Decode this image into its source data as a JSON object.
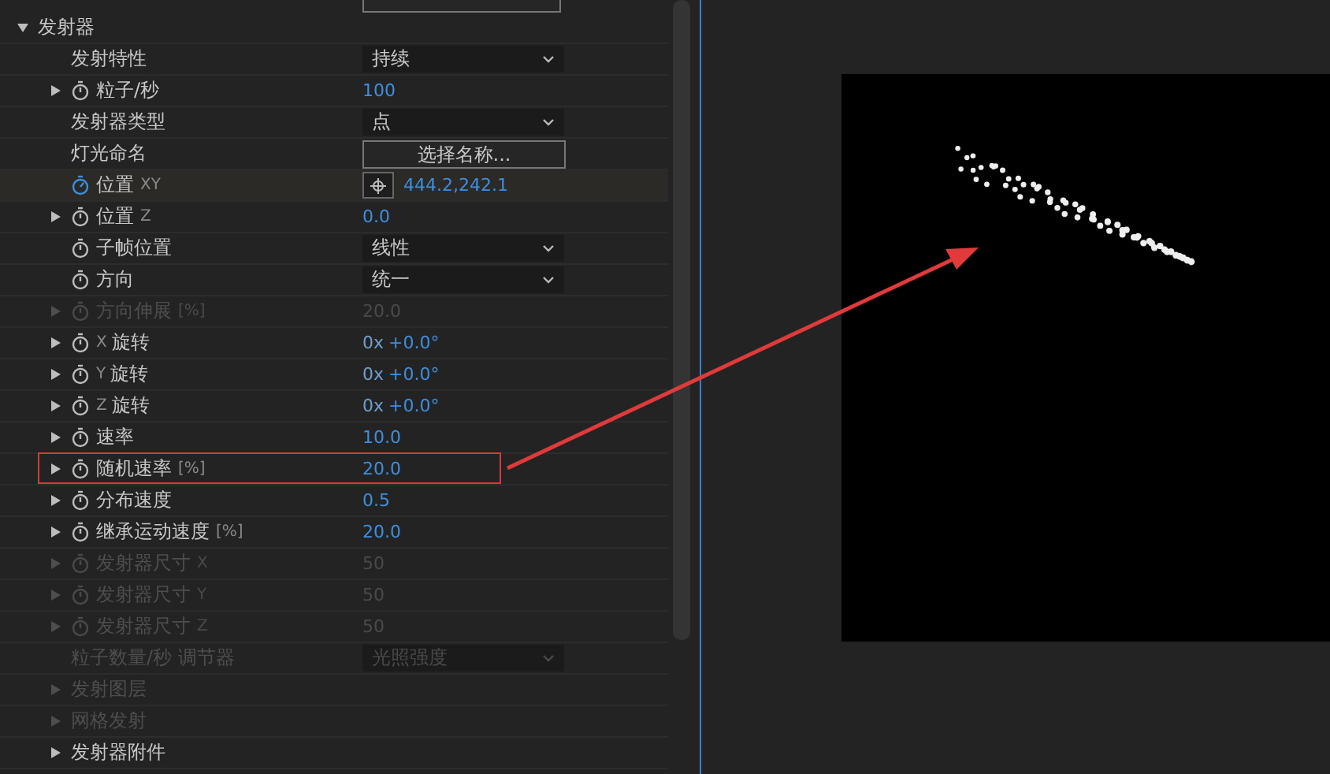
{
  "effect_group": {
    "label": "发射器",
    "expanded": true,
    "children": [
      {
        "label": "发射特性",
        "kind": "dropdown",
        "value": "持续"
      },
      {
        "label": "粒子/秒",
        "expanded": false,
        "keyframed": false,
        "kind": "number",
        "value": "100"
      },
      {
        "label": "发射器类型",
        "kind": "dropdown",
        "value": "点"
      },
      {
        "label": "灯光命名",
        "kind": "button",
        "value": "选择名称..."
      },
      {
        "label": "位置",
        "suffix": "XY",
        "keyframed": true,
        "selected": true,
        "kind": "position",
        "value": "444.2,242.1"
      },
      {
        "label": "位置",
        "suffix": "Z",
        "expanded": false,
        "keyframed": false,
        "kind": "number",
        "value": "0.0"
      },
      {
        "label": "子帧位置",
        "keyframed": false,
        "kind": "dropdown",
        "value": "线性"
      },
      {
        "label": "方向",
        "keyframed": false,
        "kind": "dropdown",
        "value": "统一"
      },
      {
        "label": "方向伸展",
        "suffix": "[%]",
        "expanded": false,
        "keyframed": false,
        "disabled": true,
        "kind": "number",
        "value": "20.0"
      },
      {
        "label": "旋转",
        "prefix": "X",
        "expanded": false,
        "keyframed": false,
        "kind": "angle",
        "revolutions": "0x",
        "value": "+0.0°"
      },
      {
        "label": "旋转",
        "prefix": "Y",
        "expanded": false,
        "keyframed": false,
        "kind": "angle",
        "revolutions": "0x",
        "value": "+0.0°"
      },
      {
        "label": "旋转",
        "prefix": "Z",
        "expanded": false,
        "keyframed": false,
        "kind": "angle",
        "revolutions": "0x",
        "value": "+0.0°"
      },
      {
        "label": "速率",
        "expanded": false,
        "keyframed": false,
        "kind": "number",
        "value": "10.0"
      },
      {
        "label": "随机速率",
        "suffix": "[%]",
        "expanded": false,
        "keyframed": false,
        "highlighted": true,
        "kind": "number",
        "value": "20.0"
      },
      {
        "label": "分布速度",
        "expanded": false,
        "keyframed": false,
        "kind": "number",
        "value": "0.5"
      },
      {
        "label": "继承运动速度",
        "suffix": "[%]",
        "expanded": false,
        "keyframed": false,
        "kind": "number",
        "value": "20.0"
      },
      {
        "label": "发射器尺寸",
        "suffix": "X",
        "expanded": false,
        "keyframed": false,
        "disabled": true,
        "kind": "number",
        "value": "50"
      },
      {
        "label": "发射器尺寸",
        "suffix": "Y",
        "expanded": false,
        "keyframed": false,
        "disabled": true,
        "kind": "number",
        "value": "50"
      },
      {
        "label": "发射器尺寸",
        "suffix": "Z",
        "expanded": false,
        "keyframed": false,
        "disabled": true,
        "kind": "number",
        "value": "50"
      },
      {
        "label": "粒子数量/秒 调节器",
        "disabled": true,
        "kind": "dropdown",
        "value": "光照强度"
      },
      {
        "label": "发射图层",
        "expanded": false,
        "disabled": true,
        "kind": "none"
      },
      {
        "label": "网格发射",
        "expanded": false,
        "disabled": true,
        "kind": "none"
      },
      {
        "label": "发射器附件",
        "expanded": false,
        "kind": "none"
      }
    ]
  }
}
